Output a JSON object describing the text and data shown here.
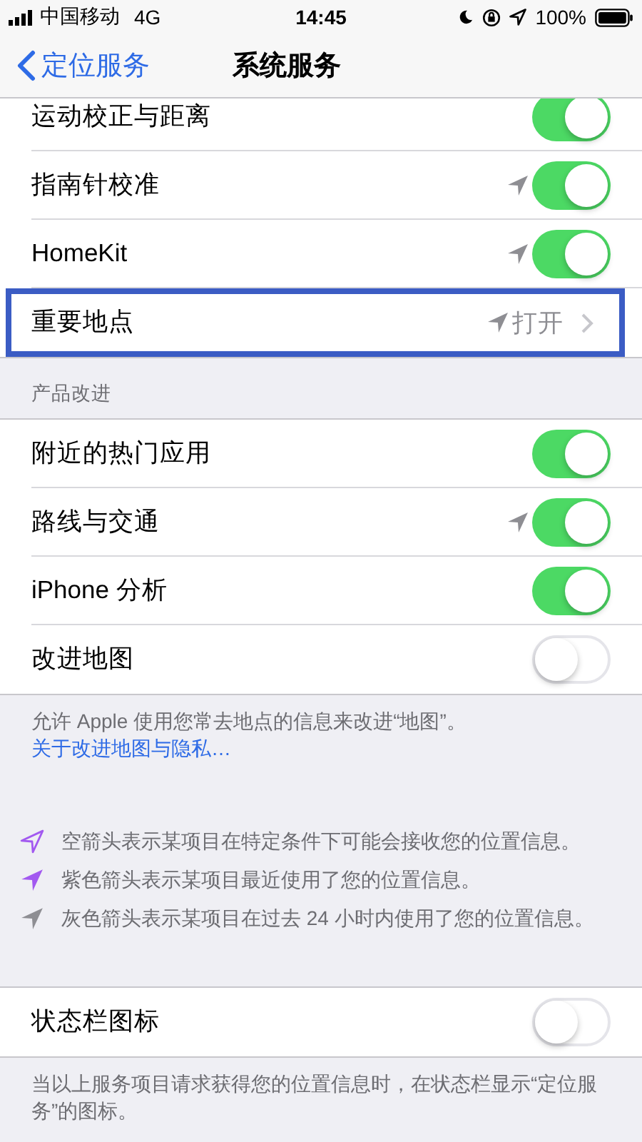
{
  "status_bar": {
    "carrier": "中国移动",
    "network": "4G",
    "time": "14:45",
    "battery": "100%"
  },
  "nav": {
    "back": "定位服务",
    "title": "系统服务"
  },
  "groups": [
    {
      "rows": [
        {
          "kind": "toggle",
          "label": "运动校正与距离",
          "location_used": false,
          "on": true,
          "highlighted": false
        },
        {
          "kind": "toggle",
          "label": "指南针校准",
          "location_used": true,
          "on": true,
          "highlighted": false
        },
        {
          "kind": "toggle",
          "label": "HomeKit",
          "location_used": true,
          "on": true,
          "highlighted": false
        },
        {
          "kind": "link",
          "label": "重要地点",
          "location_used": true,
          "value": "打开",
          "highlighted": true
        }
      ]
    },
    {
      "header": "产品改进",
      "rows": [
        {
          "kind": "toggle",
          "label": "附近的热门应用",
          "location_used": false,
          "on": true
        },
        {
          "kind": "toggle",
          "label": "路线与交通",
          "location_used": true,
          "on": true
        },
        {
          "kind": "toggle",
          "label": "iPhone 分析",
          "location_used": false,
          "on": true
        },
        {
          "kind": "toggle",
          "label": "改进地图",
          "location_used": false,
          "on": false
        }
      ],
      "footer": "允许 Apple 使用您常去地点的信息来改进“地图”。",
      "footer_link": "关于改进地图与隐私…"
    }
  ],
  "legend": [
    {
      "filled": false,
      "color": "#a259f0",
      "text": "空箭头表示某项目在特定条件下可能会接收您的位置信息。"
    },
    {
      "filled": true,
      "color": "#a259f0",
      "text": "紫色箭头表示某项目最近使用了您的位置信息。"
    },
    {
      "filled": true,
      "color": "#8e8e93",
      "text": "灰色箭头表示某项目在过去 24 小时内使用了您的位置信息。"
    }
  ],
  "status_icon_group": {
    "rows": [
      {
        "kind": "toggle",
        "label": "状态栏图标",
        "location_used": false,
        "on": false
      }
    ],
    "footer": "当以上服务项目请求获得您的位置信息时，在状态栏显示“定位服务”的图标。"
  }
}
